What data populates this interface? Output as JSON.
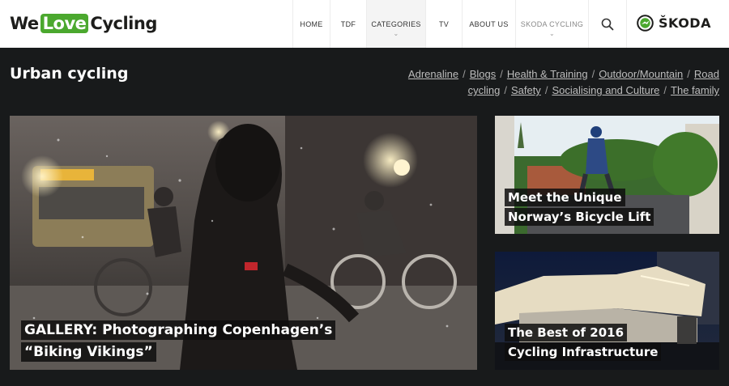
{
  "brand": {
    "pre": "We",
    "love": "Love",
    "post": "Cycling"
  },
  "nav": {
    "home": "HOME",
    "tdf": "TDF",
    "categories": "CATEGORIES",
    "tv": "TV",
    "about": "ABOUT US",
    "skoda_cycling": "SKODA CYCLING"
  },
  "sponsor": {
    "name": "ŠKODA"
  },
  "page": {
    "title": "Urban cycling"
  },
  "categories": [
    "Adrenaline",
    "Blogs",
    "Health & Training",
    "Outdoor/Mountain",
    "Road cycling",
    "Safety",
    "Socialising and Culture",
    "The family"
  ],
  "articles": {
    "main": {
      "title": "GALLERY: Photographing Copenhagen’s “Biking Vikings”"
    },
    "side_a": {
      "title": "Meet the Unique Norway’s Bicycle Lift"
    },
    "side_b": {
      "title": "The Best of 2016 Cycling Infrastructure"
    }
  },
  "colors": {
    "brand_green": "#4ba82e",
    "page_bg": "#181a1b",
    "header_bg": "#ffffff"
  },
  "icons": {
    "search": "search-icon",
    "skoda": "skoda-logo-icon",
    "chevron": "chevron-down-icon"
  }
}
